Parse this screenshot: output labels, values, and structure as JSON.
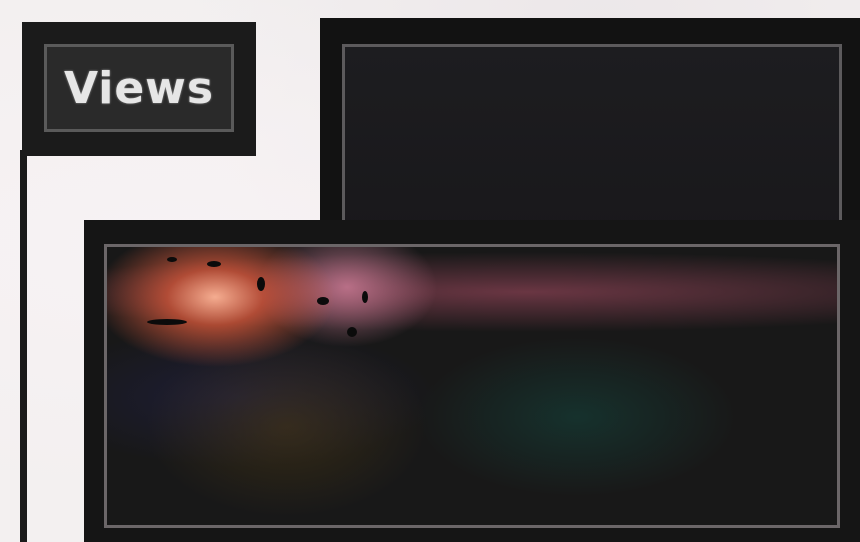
{
  "header": {
    "title": "Views"
  },
  "panels": {
    "back_panel": "view-panel-back",
    "front_panel": "view-panel-front"
  }
}
